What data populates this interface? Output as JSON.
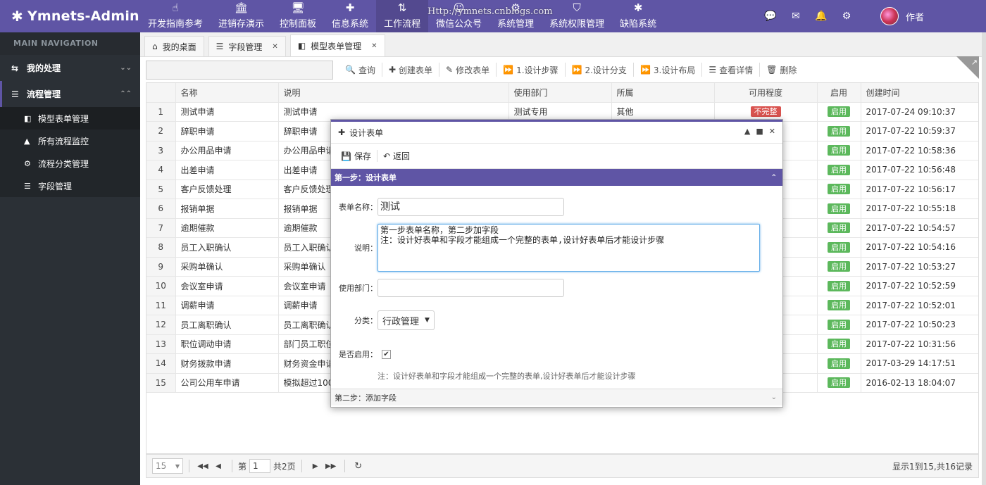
{
  "brand": {
    "logo": "✱",
    "title": "Ymnets-Admin"
  },
  "watermark": "Http://ymnets.cnblogs.com",
  "topnav": [
    {
      "icon": "☝",
      "label": "开发指南参考"
    },
    {
      "icon": "🏛",
      "label": "进销存演示"
    },
    {
      "icon": "🖥",
      "label": "控制面板"
    },
    {
      "icon": "✚",
      "label": "信息系统"
    },
    {
      "icon": "⇅",
      "label": "工作流程"
    },
    {
      "icon": "☺",
      "label": "微信公众号"
    },
    {
      "icon": "⚙",
      "label": "系统管理"
    },
    {
      "icon": "⛉",
      "label": "系统权限管理"
    },
    {
      "icon": "✱",
      "label": "缺陷系统"
    }
  ],
  "topright": {
    "user_name": "作者"
  },
  "sidebar": {
    "title": "MAIN NAVIGATION",
    "groups": [
      {
        "label": "我的处理",
        "chevron": "⌄⌄"
      },
      {
        "label": "流程管理",
        "chevron": "⌃⌃"
      }
    ],
    "items": [
      {
        "icon": "◧",
        "label": "模型表单管理"
      },
      {
        "icon": "▲",
        "label": "所有流程监控"
      },
      {
        "icon": "⚙",
        "label": "流程分类管理"
      },
      {
        "icon": "☰",
        "label": "字段管理"
      }
    ]
  },
  "tabs": [
    {
      "icon": "⌂",
      "label": "我的桌面",
      "closable": false
    },
    {
      "icon": "☰",
      "label": "字段管理",
      "closable": true
    },
    {
      "icon": "◧",
      "label": "模型表单管理",
      "closable": true
    }
  ],
  "toolbar": {
    "buttons": [
      {
        "icon": "🔍",
        "label": "查询"
      },
      {
        "icon": "✚",
        "label": "创建表单"
      },
      {
        "icon": "✎",
        "label": "修改表单"
      },
      {
        "icon": "⏩",
        "label": "1.设计步骤"
      },
      {
        "icon": "⏩",
        "label": "2.设计分支"
      },
      {
        "icon": "⏩",
        "label": "3.设计布局"
      },
      {
        "icon": "☰",
        "label": "查看详情"
      },
      {
        "icon": "🗑",
        "label": "删除"
      }
    ]
  },
  "grid": {
    "headers": [
      "",
      "名称",
      "说明",
      "使用部门",
      "所属",
      "可用程度",
      "启用",
      "创建时间"
    ],
    "rows": [
      [
        "1",
        "测试申请",
        "测试申请",
        "测试专用",
        "其他",
        "不完整",
        "启用",
        "2017-07-24 09:10:37"
      ],
      [
        "2",
        "辞职申请",
        "辞职申请",
        "",
        "",
        "",
        "启用",
        "2017-07-22 10:59:37"
      ],
      [
        "3",
        "办公用品申请",
        "办公用品申请",
        "",
        "",
        "",
        "启用",
        "2017-07-22 10:58:36"
      ],
      [
        "4",
        "出差申请",
        "出差申请",
        "",
        "",
        "",
        "启用",
        "2017-07-22 10:56:48"
      ],
      [
        "5",
        "客户反馈处理",
        "客户反馈处理",
        "",
        "",
        "",
        "启用",
        "2017-07-22 10:56:17"
      ],
      [
        "6",
        "报销单据",
        "报销单据",
        "",
        "",
        "",
        "启用",
        "2017-07-22 10:55:18"
      ],
      [
        "7",
        "逾期催款",
        "逾期催款",
        "",
        "",
        "",
        "启用",
        "2017-07-22 10:54:57"
      ],
      [
        "8",
        "员工入职确认",
        "员工入职确认",
        "",
        "",
        "",
        "启用",
        "2017-07-22 10:54:16"
      ],
      [
        "9",
        "采购单确认",
        "采购单确认",
        "",
        "",
        "",
        "启用",
        "2017-07-22 10:53:27"
      ],
      [
        "10",
        "会议室申请",
        "会议室申请",
        "",
        "",
        "",
        "启用",
        "2017-07-22 10:52:59"
      ],
      [
        "11",
        "调薪申请",
        "调薪申请",
        "",
        "",
        "",
        "启用",
        "2017-07-22 10:52:01"
      ],
      [
        "12",
        "员工离职确认",
        "员工离职确认",
        "",
        "",
        "",
        "启用",
        "2017-07-22 10:50:23"
      ],
      [
        "13",
        "职位调动申请",
        "部门员工职位",
        "",
        "",
        "",
        "启用",
        "2017-07-22 10:31:56"
      ],
      [
        "14",
        "财务拨款申请",
        "财务资金申请",
        "",
        "",
        "",
        "启用",
        "2017-03-29 14:17:51"
      ],
      [
        "15",
        "公司公用车申请",
        "模拟超过100公",
        "",
        "",
        "",
        "启用",
        "2016-02-13 18:04:07"
      ]
    ]
  },
  "pager": {
    "page_size": "15",
    "page_label": "第",
    "page_value": "1",
    "total_pages": "共2页",
    "info": "显示1到15,共16记录"
  },
  "dialog": {
    "title": "设计表单",
    "save_label": "保存",
    "back_label": "返回",
    "step1": "第一步：设计表单",
    "step2": "第二步：添加字段",
    "form": {
      "name_label": "表单名称：",
      "name_value": "测试",
      "desc_label": "说明：",
      "desc_value": "第一步表单名称，第二步加字段\n注：设计好表单和字段才能组成一个完整的表单,设计好表单后才能设计步骤",
      "dept_label": "使用部门：",
      "dept_value": "",
      "category_label": "分类：",
      "category_value": "行政管理",
      "enabled_label": "是否启用：",
      "note": "注：设计好表单和字段才能组成一个完整的表单,设计好表单后才能设计步骤"
    }
  },
  "colors": {
    "accent": "#5f55a5",
    "sidebar_bg": "#2b3036",
    "badge_green": "#5cb85c",
    "badge_red": "#d9534f"
  }
}
